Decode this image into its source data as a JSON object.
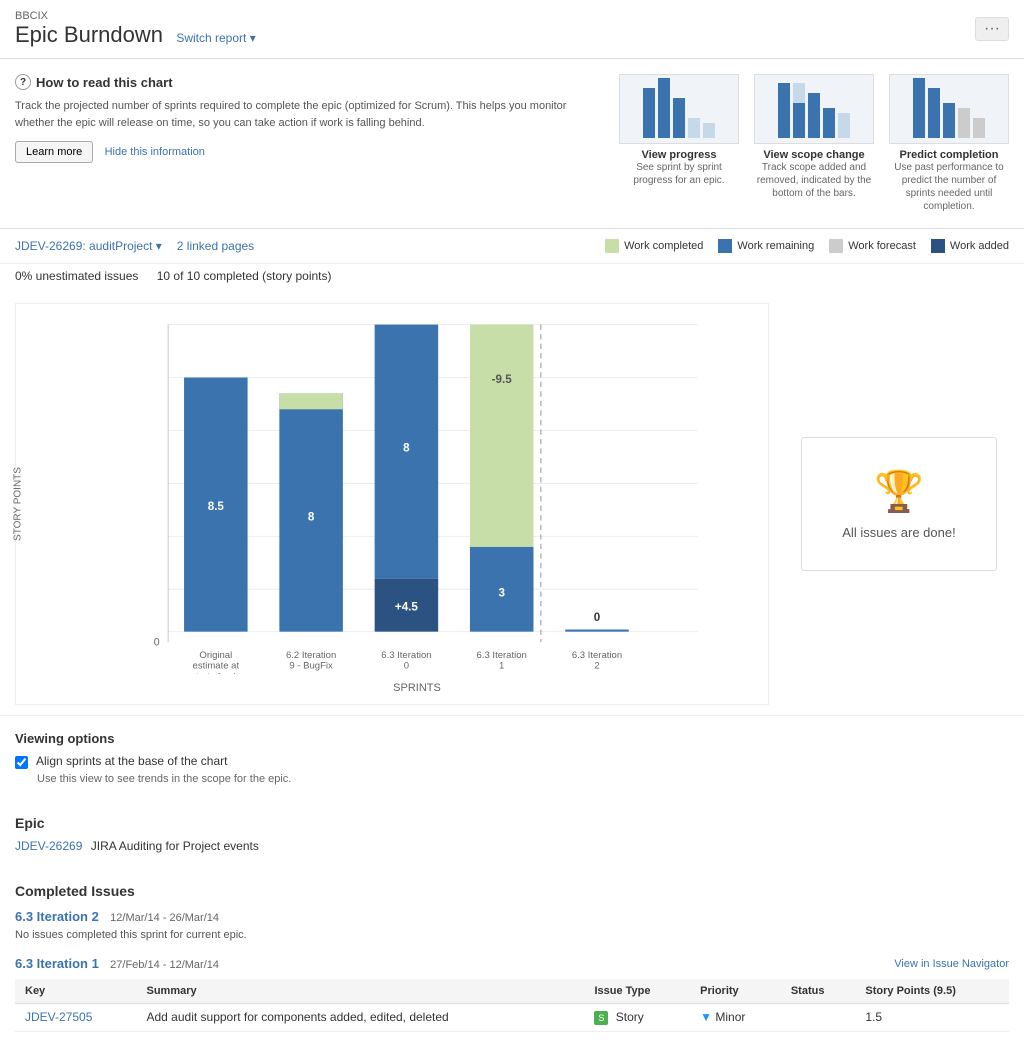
{
  "header": {
    "project_id": "BBCIX",
    "title": "Epic Burndown",
    "switch_report_label": "Switch report ▾",
    "three_dots": "···"
  },
  "info_section": {
    "title": "How to read this chart",
    "question_icon": "?",
    "description": "Track the projected number of sprints required to complete the epic (optimized for Scrum). This helps you monitor whether the epic will release on time, so you can take action if work is falling behind.",
    "learn_more_label": "Learn more",
    "hide_info_label": "Hide this information",
    "previews": [
      {
        "title": "View progress",
        "description": "See sprint by sprint progress for an epic."
      },
      {
        "title": "View scope change",
        "description": "Track scope added and removed, indicated by the bottom of the bars."
      },
      {
        "title": "Predict completion",
        "description": "Use past performance to predict the number of sprints needed until completion."
      }
    ]
  },
  "toolbar": {
    "project_selector": "JDEV-26269: auditProject ▾",
    "linked_pages": "2 linked pages",
    "legend": {
      "work_completed": "Work completed",
      "work_remaining": "Work remaining",
      "work_forecast": "Work forecast",
      "work_added": "Work added"
    }
  },
  "stats": {
    "unestimated": "0% unestimated issues",
    "completed": "10 of 10 completed (story points)"
  },
  "chart": {
    "y_label": "STORY POINTS",
    "x_label": "SPRINTS",
    "y_axis_max": 0,
    "bars": [
      {
        "label": "Original\nestimate at\nstart of epic",
        "remaining": 8.5,
        "completed": 0,
        "added": 0,
        "forecast": 0,
        "value_label": "8.5"
      },
      {
        "label": "6.2 Iteration\n9 - BugFix",
        "remaining": 8,
        "completed": 0.5,
        "added": 0,
        "forecast": 0,
        "value_label": "8"
      },
      {
        "label": "6.3 Iteration\n0",
        "remaining": 8,
        "completed": 0,
        "added": 4.5,
        "forecast": 0,
        "value_label": "8",
        "added_label": "+4.5"
      },
      {
        "label": "6.3 Iteration\n1",
        "remaining": 3,
        "completed": 0,
        "added": 0,
        "forecast": 9.5,
        "value_label": "3",
        "forecast_label": "-9.5"
      },
      {
        "label": "6.3 Iteration\n2",
        "remaining": 0,
        "completed": 0,
        "added": 0,
        "forecast": 0,
        "value_label": "0"
      }
    ],
    "dashed_line_after": 3,
    "all_done_text": "All issues are done!"
  },
  "viewing_options": {
    "title": "Viewing options",
    "align_label": "Align sprints at the base of the chart",
    "align_desc": "Use this view to see trends in the scope for the epic.",
    "align_checked": true
  },
  "epic_section": {
    "title": "Epic",
    "epic_key": "JDEV-26269",
    "epic_name": "JIRA Auditing for Project events"
  },
  "completed_section": {
    "title": "Completed Issues",
    "sprints": [
      {
        "name": "6.3 Iteration 2",
        "dates": "12/Mar/14 - 26/Mar/14",
        "note": "No issues completed this sprint for current epic.",
        "issues": []
      },
      {
        "name": "6.3 Iteration 1",
        "dates": "27/Feb/14 - 12/Mar/14",
        "view_navigator": "View in Issue Navigator",
        "issues": [
          {
            "key": "JDEV-27505",
            "summary": "Add audit support for components added, edited, deleted",
            "issue_type": "Story",
            "priority": "Minor",
            "status": "",
            "story_points": "1.5"
          }
        ]
      }
    ],
    "table_headers": {
      "key": "Key",
      "summary": "Summary",
      "issue_type": "Issue Type",
      "priority": "Priority",
      "status": "Status",
      "story_points": "Story Points (9.5)"
    }
  }
}
